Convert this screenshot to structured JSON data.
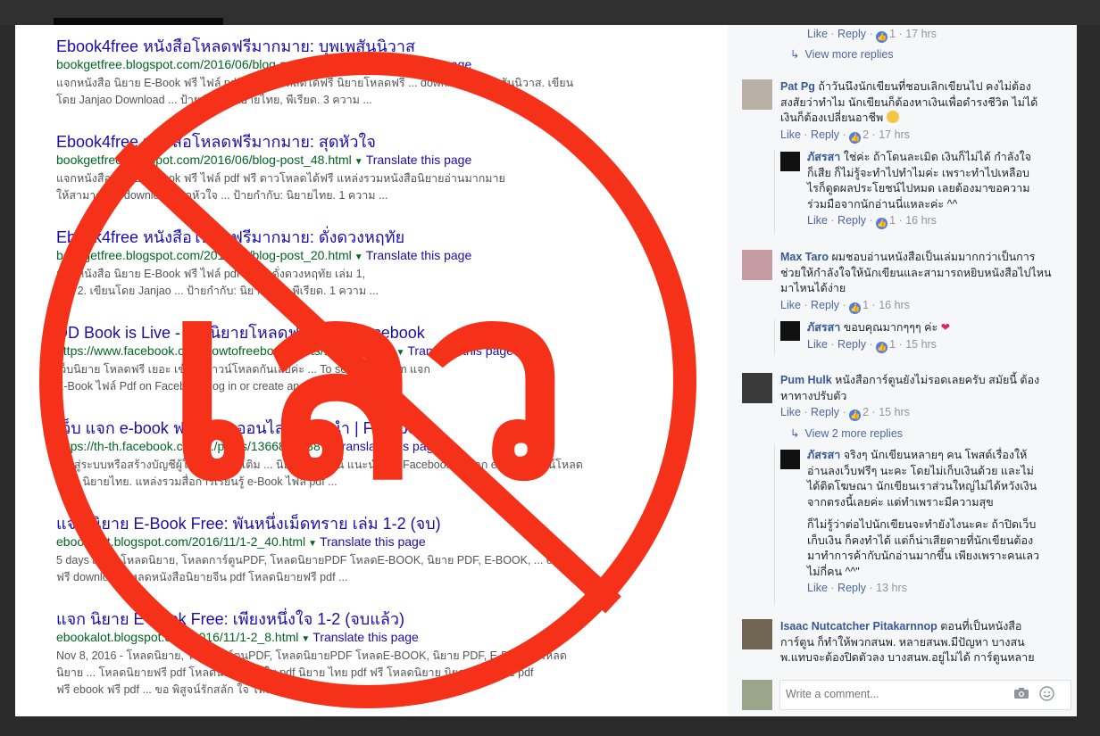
{
  "search": {
    "results": [
      {
        "title": "Ebook4free หนังสือโหลดฟรีมากมาย: บุพเพสันนิวาส",
        "url": "bookgetfree.blogspot.com/2016/06/blog-post_45.html",
        "translate": "Translate this page",
        "snippet1": "แจกหนังสือ นิยาย E-Book ฟรี ไฟล์ pdf ฟรี ดาวโหลดได้ฟรี นิยายโหลดฟรี ... download: บุพเพสันนิวาส. เขียน",
        "snippet2": "โดย Janjao Download ... ป้ายกำกับ: นิยายไทย, พีเรียด. 3 ความ ..."
      },
      {
        "title": "Ebook4free หนังสือโหลดฟรีมากมาย: สุดหัวใจ",
        "url": "bookgetfree.blogspot.com/2016/06/blog-post_48.html",
        "translate": "Translate this page",
        "snippet1": "แจกหนังสือ นิยาย E-Book ฟรี ไฟล์ pdf ฟรี ดาวโหลดได้ฟรี แหล่งรวมหนังสือนิยายอ่านมากมาย",
        "snippet2": "ให้สามารถ ... download: สุดหัวใจ ... ป้ายกำกับ: นิยายไทย. 1 ความ ..."
      },
      {
        "title": "Ebook4free หนังสือโหลดฟรีมากมาย: ดั่งดวงหฤทัย",
        "url": "bookgetfree.blogspot.com/2016/06/blog-post_20.html",
        "translate": "Translate this page",
        "snippet1": "แจกหนังสือ นิยาย E-Book ฟรี ไฟล์ pdf ฟรี ... ดั่งดวงหฤทัย เล่ม 1,",
        "snippet2": "เล่ม 2. เขียนโดย Janjao ... ป้ายกำกับ: นิยายไทย, พีเรียด. 1 ความ ..."
      },
      {
        "title": "DD Book is Live - เว็บนิยายโหลดฟรีเยอะ | Facebook",
        "url": "https://www.facebook.com/howtofreebook/posts/1377810081",
        "translate": "Translate this page",
        "snippet1": "เว็บนิยาย โหลดฟรี เยอะ เข้าไปดาวน์โหลดกันเลยค่ะ ... To see more from แจก",
        "snippet2": "E-Book ไฟล์ Pdf on Facebook, log in or create an account."
      },
      {
        "title": "เว็บ แจก e-book ฟรี นิยายออนไลน์ แนะนำ | Facebook",
        "url": "https://th-th.facebook.com/.../posts/1366836238",
        "translate": "Translate this page",
        "snippet1": "เข้าสู่ระบบหรือสร้างบัญชีผู้ใช้ เพื่อดูเพิ่มเติม ... นิยายออนไลน์ แนะนำ บน Facebook ... แจก e-book ดาวน์โหลด",
        "snippet2": "ฟรี !: นิยายไทย. แหล่งรวมสื่อการเรียนรู้ e-Book ไฟล์ pdf ..."
      },
      {
        "title": "แจก นิยาย E-Book Free: พันหนึ่งเม็ดทราย เล่ม 1-2 (จบ)",
        "url": "ebookalot.blogspot.com/2016/11/1-2_40.html",
        "translate": "Translate this page",
        "snippet1": "5 days ago - โหลดนิยาย, โหลดการ์ตูนPDF, โหลดนิยายPDF โหลดE-BOOK, นิยาย PDF, E-BOOK, ... ebook",
        "snippet2": "ฟรี download โหลดหนังสือนิยายจีน pdf โหลดนิยายฟรี pdf ..."
      },
      {
        "title": "แจก นิยาย E-Book Free: เพียงหนึ่งใจ 1-2 (จบแล้ว)",
        "url": "ebookalot.blogspot.com/2016/11/1-2_8.html",
        "translate": "Translate this page",
        "snippet1": "Nov 8, 2016 - โหลดนิยาย, โหลดการ์ตูนPDF, โหลดนิยายPDF โหลดE-BOOK, นิยาย PDF, E-BOOK, โหลด",
        "snippet2": "นิยาย ... โหลดนิยายฟรี pdf โหลดนิยาย เล่มใส pdf นิยาย ไทย pdf ฟรี โหลดนิยาย นิยายแฟนตาซี pdf",
        "snippet3": "ฟรี ebook ฟรี pdf ... ขอ พิสูจน์รักสลัก ใจ โหลด ..."
      }
    ]
  },
  "overlay": {
    "big_text": "เลว",
    "color": "#f5311a"
  },
  "comments": {
    "actions": {
      "like": "Like",
      "reply": "Reply"
    },
    "top_actions": {
      "count": "1",
      "time": "17 hrs"
    },
    "view_more": "View more replies",
    "items": [
      {
        "name": "Pat Pg",
        "text1": "ถ้าวันนึงนักเขียนที่ชอบเลิกเขียนไป คงไม่ต้อง",
        "text2": "สงสัยว่าทำไม นักเขียนก็ต้องหาเงินเพื่อดำรงชีวิต ไม่ได้",
        "text3": "เงินก็ต้องเปลี่ยนอาชีพ",
        "count": "2",
        "time": "17 hrs",
        "reply": {
          "name": "ภัสรสา",
          "text1": "ใช่ค่ะ ถ้าโดนละเมิด เงินก็ไม่ได้ กำลังใจ",
          "text2": "ก็เสีย ก็ไม่รู้จะทำไปทำไมค่ะ เพราะทำไปเหลือบ",
          "text3": "ไรก็ดูดผลประโยชน์ไปหมด เลยต้องมาขอความ",
          "text4": "ร่วมมือจากนักอ่านนี่แหละค่ะ ^^",
          "count": "1",
          "time": "16 hrs"
        }
      },
      {
        "name": "Max Taro",
        "text1": "ผมชอบอ่านหนังสือเป็นเล่มมากกว่าเป็นการ",
        "text2": "ช่วยให้กำลังใจให้นักเขียนและสามารถหยิบหนังสือไปไหน",
        "text3": "มาไหนได้ง่าย",
        "count": "1",
        "time": "16 hrs",
        "reply": {
          "name": "ภัสรสา",
          "text1": "ขอบคุณมากๆๆๆ ค่ะ",
          "count": "1",
          "time": "15 hrs"
        }
      },
      {
        "name": "Pum Hulk",
        "text1": "หนังสือการ์ตูนยังไม่รอดเลยครับ สมัยนี้ ต้อง",
        "text2": "หาทางปรับตัว",
        "count": "2",
        "time": "15 hrs",
        "view_more": "View 2 more replies",
        "reply": {
          "name": "ภัสรสา",
          "text1": "จริงๆ นักเขียนหลายๆ คน โพสต์เรื่องให้",
          "text2": "อ่านลงเว็บฟรีๆ นะคะ โดยไม่เก็บเงินด้วย และไม่",
          "text3": "ได้ติดโฆษณา นักเขียนเราส่วนใหญ่ไม่ได้หวังเงิน",
          "text4": "จากตรงนี้เลยค่ะ แต่ทำเพราะมีความสุข",
          "text5": "ก็ไม่รู้ว่าต่อไปนักเขียนจะทำยังไงนะคะ ถ้าปิดเว็บ",
          "text6": "เก็บเงิน ก็คงทำได้ แต่ก็น่าเสียดายที่นักเขียนต้อง",
          "text7": "มาทำการค้ากับนักอ่านมากขึ้น เพียงเพราะคนเลว",
          "text8": "ไม่กี่คน ^^\"",
          "time": "13 hrs"
        }
      },
      {
        "name": "Isaac Nutcatcher Pitakarnnop",
        "text1": "ตอนที่เป็นหนังสือ",
        "text2": "การ์ตูน ก็ทำให้พวกสนพ. หลายสนพ.มีปัญหา บางสน",
        "text3": "พ.แทบจะต้องปิดตัวลง บางสนพ.อยู่ไม่ได้ การ์ตูนหลาย"
      }
    ],
    "write_placeholder": "Write a comment..."
  }
}
